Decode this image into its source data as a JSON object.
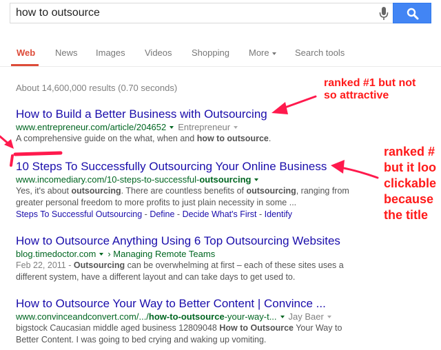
{
  "search": {
    "query": "how to outsource"
  },
  "tabs": [
    {
      "label": "Web",
      "active": true
    },
    {
      "label": "News"
    },
    {
      "label": "Images"
    },
    {
      "label": "Videos"
    },
    {
      "label": "Shopping"
    },
    {
      "label": "More"
    },
    {
      "label": "Search tools"
    }
  ],
  "result_stats": "About 14,600,000 results (0.70 seconds)",
  "results": [
    {
      "title": "How to Build a Better Business with Outsourcing",
      "url": "www.entrepreneur.com/article/204652",
      "url_extra": "Entrepreneur",
      "snippet_pre": "A comprehensive guide on the what, when and ",
      "snippet_bold": "how to outsource",
      "snippet_post": "."
    },
    {
      "title": "10 Steps To Successfully Outsourcing Your Online Business",
      "url_pre": "www.incomediary.com/10-steps-to-successful-",
      "url_bold": "outsourcing",
      "snippet_line1_a": "Yes, it's about ",
      "snippet_line1_b": "outsourcing",
      "snippet_line1_c": ". There are countless benefits of ",
      "snippet_line1_d": "outsourcing",
      "snippet_line1_e": ", ranging from",
      "snippet_line2": "greater personal freedom to more profits to just plain necessity in some ...",
      "sitelinks": [
        "Steps To Successful Outsourcing",
        "Define",
        "Decide What's First",
        "Identify"
      ]
    },
    {
      "title": "How to Outsource Anything Using 6 Top Outsourcing Websites",
      "url": "blog.timedoctor.com",
      "url_extra": "Managing Remote Teams",
      "date": "Feb 22, 2011 - ",
      "snippet_bold": "Outsourcing",
      "snippet_line1": " can be overwhelming at first – each of these sites uses a",
      "snippet_line2": "different system, have a different layout and can take days to get used to."
    },
    {
      "title": "How to Outsource Your Way to Better Content | Convince ...",
      "url_pre": "www.convinceandconvert.com/.../",
      "url_bold": "how-to-outsource",
      "url_post": "-your-way-t...",
      "url_extra": "Jay Baer",
      "snippet_line1_a": "bigstock Caucasian middle aged business 12809048 ",
      "snippet_line1_b": "How to Outsource",
      "snippet_line1_c": " Your Way to",
      "snippet_line2": "Better Content. I was going to bed crying and waking up vomiting."
    }
  ],
  "annotations": {
    "first": [
      "ranked #1 but not",
      "so attractive"
    ],
    "second": [
      "ranked #",
      "but it loo",
      "clickable",
      "because",
      "the title"
    ],
    "color": "#ff1a1a"
  },
  "colors": {
    "link": "#1a0dab",
    "url": "#006621",
    "accent": "#dd4b39",
    "search_button": "#4285f4"
  }
}
